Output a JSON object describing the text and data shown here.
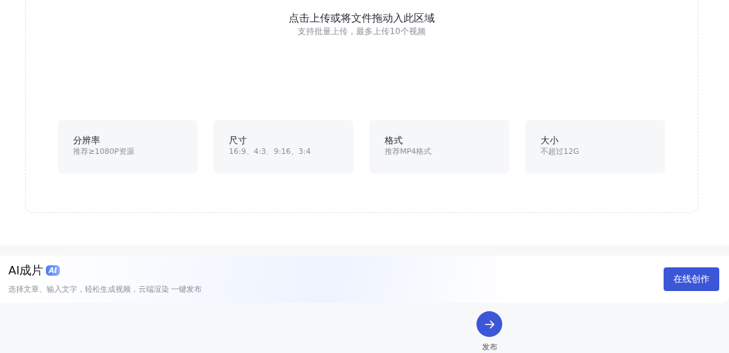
{
  "upload": {
    "title": "点击上传或将文件拖动入此区域",
    "subtitle": "支持批量上传，最多上传10个视频",
    "specs": [
      {
        "label": "分辨率",
        "value": "推荐≥1080P资源"
      },
      {
        "label": "尺寸",
        "value": "16:9、4:3、9:16、3:4"
      },
      {
        "label": "格式",
        "value": "推荐MP4格式"
      },
      {
        "label": "大小",
        "value": "不超过12G"
      }
    ]
  },
  "ai_section": {
    "title": "AI成片",
    "badge": "AI",
    "description": "选择文章、输入文字，轻松生成视频，云端渲染 一键发布",
    "button": "在线创作"
  },
  "publish": {
    "label": "发布"
  }
}
